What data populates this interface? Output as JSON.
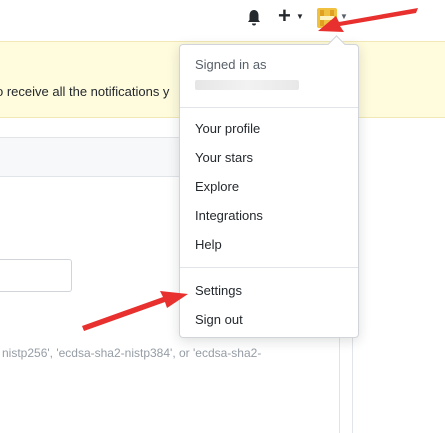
{
  "banner": {
    "text": "o receive all the notifications y"
  },
  "form": {
    "hint": "nistp256', 'ecdsa-sha2-nistp384', or 'ecdsa-sha2-"
  },
  "header": {
    "notifications_icon": "bell-icon",
    "create_icon": "plus-icon",
    "avatar_icon": "avatar-icon"
  },
  "user_menu": {
    "signed_in_label": "Signed in as",
    "items": [
      "Your profile",
      "Your stars",
      "Explore",
      "Integrations",
      "Help"
    ],
    "settings": "Settings",
    "sign_out": "Sign out"
  },
  "annotations": {
    "arrow_color": "#e8302e"
  }
}
